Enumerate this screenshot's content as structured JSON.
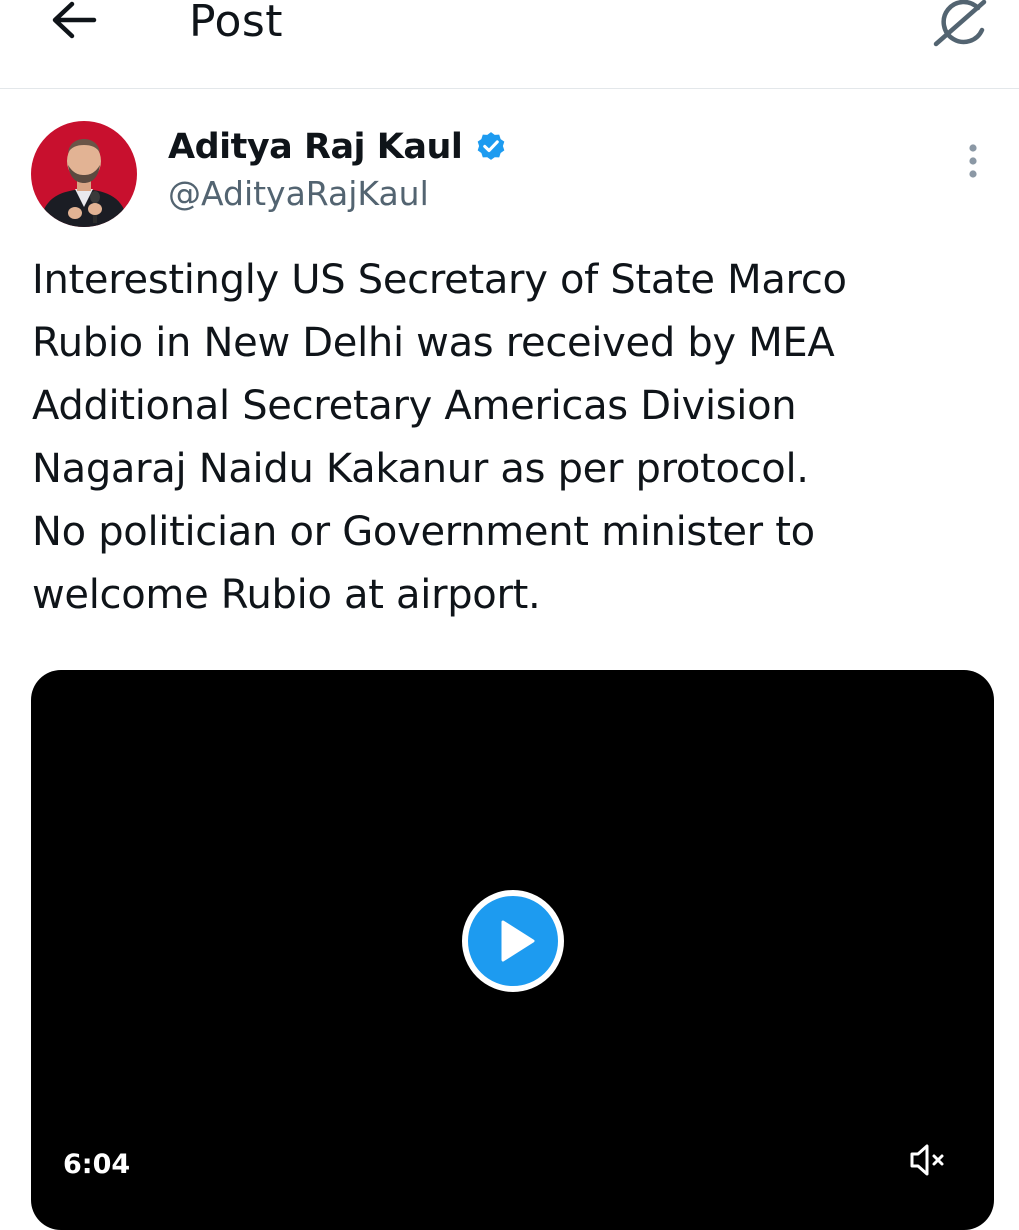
{
  "header": {
    "title": "Post",
    "back_icon": "arrow-left-icon",
    "grok_icon": "grok-icon"
  },
  "post": {
    "author": {
      "display_name": "Aditya Raj Kaul",
      "handle": "@AdityaRajKaul",
      "verified": true,
      "verified_color": "#1d9bf0"
    },
    "more_icon": "more-vertical-icon",
    "text": "Interestingly US Secretary of State Marco\nRubio in New Delhi was received by MEA\nAdditional Secretary Americas Division\nNagaraj Naidu Kakanur as per protocol.\nNo politician or Government minister to\nwelcome Rubio at airport.",
    "video": {
      "duration": "6:04",
      "play_icon": "play-icon",
      "mute_icon": "speaker-muted-icon",
      "accent_color": "#1d9bf0"
    }
  },
  "colors": {
    "text_primary": "#0f1419",
    "text_secondary": "#536471",
    "divider": "#e3e7ea",
    "avatar_background": "#c8102e"
  }
}
